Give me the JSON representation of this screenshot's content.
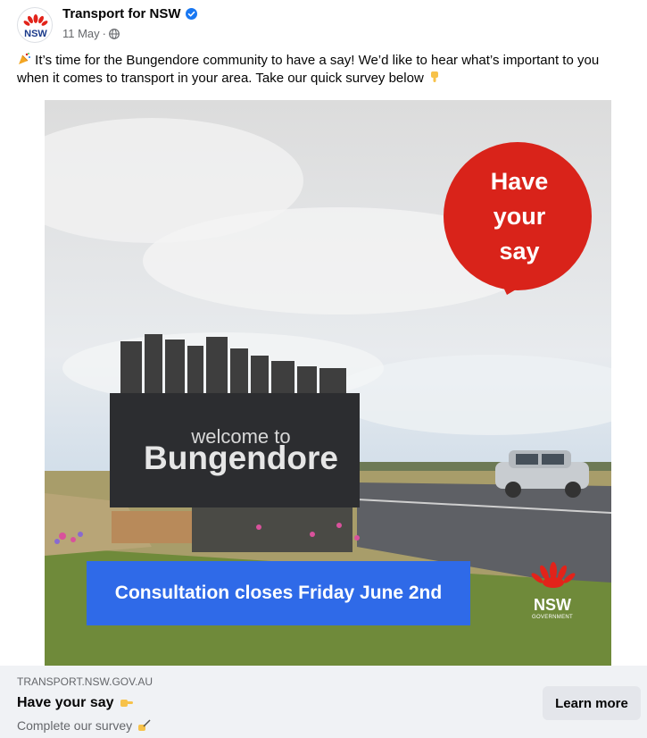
{
  "post": {
    "page_name": "Transport for NSW",
    "avatar_text": "NSW",
    "date": "11 May",
    "separator": "·",
    "privacy_icon": "globe-icon",
    "verified_icon": "verified-badge-icon",
    "caption_emoji": "party-popper-icon",
    "caption": "It’s time for the Bungendore community to have a say! We’d like to hear what’s important to you when it comes to transport in your area. Take our quick survey below",
    "caption_end_emoji": "pointing-down-hand-icon"
  },
  "image": {
    "bubble_lines": [
      "Have",
      "your",
      "say"
    ],
    "sign_small": "welcome to",
    "sign_big": "Bungendore",
    "banner": "Consultation closes Friday June 2nd",
    "logo_word": "NSW",
    "logo_sub": "GOVERNMENT",
    "colors": {
      "bubble": "#d9231a",
      "banner": "#2f6ae8",
      "waratah": "#e2231a"
    }
  },
  "link_card": {
    "domain": "TRANSPORT.NSW.GOV.AU",
    "title": "Have your say",
    "title_emoji": "pointing-right-hand-icon",
    "description": "Complete our survey",
    "description_emoji": "writing-hand-icon",
    "button_label": "Learn more"
  }
}
